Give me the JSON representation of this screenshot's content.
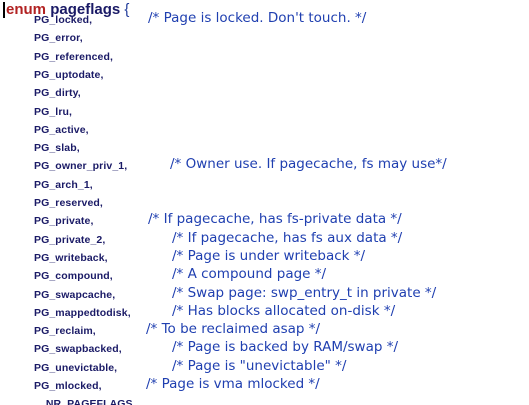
{
  "declaration": {
    "keyword": "enum",
    "name": "pageflags",
    "brace": "{"
  },
  "flags": [
    {
      "name": "PG_locked,",
      "comment": "/* Page is locked. Don't touch. */"
    },
    {
      "name": "PG_error,",
      "comment": ""
    },
    {
      "name": "PG_referenced,",
      "comment": ""
    },
    {
      "name": "PG_uptodate,",
      "comment": ""
    },
    {
      "name": "PG_dirty,",
      "comment": ""
    },
    {
      "name": "PG_lru,",
      "comment": ""
    },
    {
      "name": "PG_active,",
      "comment": ""
    },
    {
      "name": "PG_slab,",
      "comment": ""
    },
    {
      "name": "PG_owner_priv_1,",
      "comment": "/* Owner use. If pagecache, fs may use*/"
    },
    {
      "name": "PG_arch_1,",
      "comment": ""
    },
    {
      "name": "PG_reserved,",
      "comment": ""
    },
    {
      "name": "PG_private,",
      "comment": "/* If pagecache, has fs-private data */"
    },
    {
      "name": "PG_private_2,",
      "comment": "/* If pagecache, has fs aux data */"
    },
    {
      "name": "PG_writeback,",
      "comment": "/* Page is under writeback */"
    },
    {
      "name": "PG_compound,",
      "comment": "/* A compound page */"
    },
    {
      "name": "PG_swapcache,",
      "comment": "/* Swap page: swp_entry_t in private */"
    },
    {
      "name": "PG_mappedtodisk,",
      "comment": "/* Has blocks allocated on-disk */"
    },
    {
      "name": "PG_reclaim,",
      "comment": "/* To be reclaimed asap */"
    },
    {
      "name": "PG_swapbacked,",
      "comment": "/* Page is backed by RAM/swap */"
    },
    {
      "name": "PG_unevictable,",
      "comment": "/* Page is \"unevictable\" */"
    },
    {
      "name": "PG_mlocked,",
      "comment": "/* Page is vma mlocked */"
    },
    {
      "name": "__NR_PAGEFLAGS,",
      "comment": ""
    }
  ]
}
